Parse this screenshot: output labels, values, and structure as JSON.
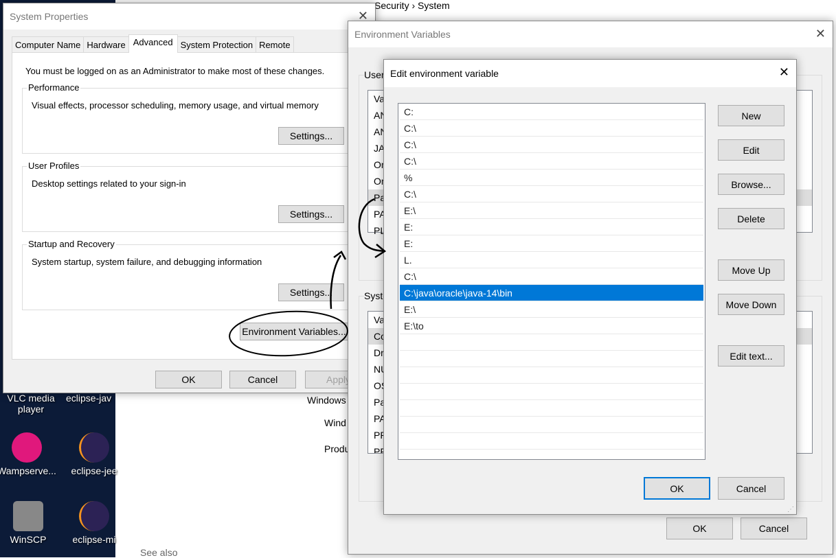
{
  "background": {
    "breadcrumb": [
      "Security",
      "System"
    ],
    "desktop_icons": [
      "VLC media player",
      "eclipse-jav",
      "Wampserve...",
      "eclipse-jee",
      "WinSCP",
      "eclipse-mi"
    ],
    "control_panel_text": [
      "Windows",
      "Wind",
      "Produ",
      "See also"
    ]
  },
  "system_properties": {
    "title": "System Properties",
    "tabs": [
      "Computer Name",
      "Hardware",
      "Advanced",
      "System Protection",
      "Remote"
    ],
    "selected_tab": "Advanced",
    "admin_note": "You must be logged on as an Administrator to make most of these changes.",
    "groups": [
      {
        "label": "Performance",
        "desc": "Visual effects, processor scheduling, memory usage, and virtual memory",
        "button": "Settings..."
      },
      {
        "label": "User Profiles",
        "desc": "Desktop settings related to your sign-in",
        "button": "Settings..."
      },
      {
        "label": "Startup and Recovery",
        "desc": "System startup, system failure, and debugging information",
        "button": "Settings..."
      }
    ],
    "env_button": "Environment Variables...",
    "ok": "OK",
    "cancel": "Cancel",
    "apply": "Apply"
  },
  "env_vars": {
    "title": "Environment Variables",
    "user_label": "User",
    "user_rows": [
      "Va",
      "AN",
      "AN",
      "JA",
      "On",
      "On",
      "Pa",
      "PA",
      "PL"
    ],
    "system_label": "Syste",
    "system_rows": [
      "Va",
      "Co",
      "Dr",
      "NU",
      "OS",
      "Pa",
      "PA",
      "PR",
      "PR"
    ],
    "ok": "OK",
    "cancel": "Cancel"
  },
  "edit_var": {
    "title": "Edit environment variable",
    "entries": [
      "C:",
      "C:\\",
      "C:\\",
      "C:\\",
      "%",
      "C:\\",
      "E:\\",
      "E:",
      "E:",
      "L.",
      "C:\\",
      "C:\\java\\oracle\\java-14\\bin",
      "E:\\",
      "E:\\to"
    ],
    "selected_index": 11,
    "buttons": [
      "New",
      "Edit",
      "Browse...",
      "Delete",
      "Move Up",
      "Move Down",
      "Edit text..."
    ],
    "ok": "OK",
    "cancel": "Cancel"
  },
  "colors": {
    "selection": "#0078d7",
    "desktop": "#0c1b38"
  }
}
